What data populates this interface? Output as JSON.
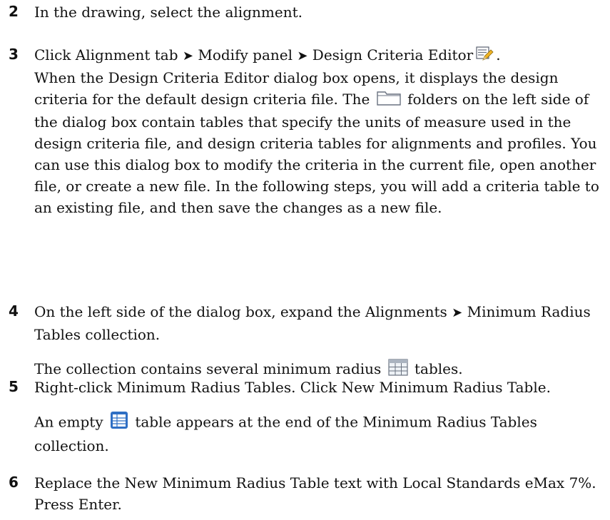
{
  "steps": [
    {
      "number": "2",
      "text": "In the drawing, select the alignment."
    },
    {
      "number": "3",
      "instruction": {
        "a": "Click Alignment tab",
        "b": "Modify panel",
        "c": "Design Criteria Editor",
        "d": "."
      },
      "note": {
        "a": "When the Design Criteria Editor dialog box opens, it displays the design criteria for the default design criteria file. The",
        "b": "folders on the left side of the dialog box contain tables that specify the units of measure used in the design criteria file, and design criteria tables for alignments and profiles. You can use this dialog box to modify the criteria in the current file, open another file, or create a new file. In the following steps, you will add a criteria table to an existing file, and then save the changes as a new file."
      }
    },
    {
      "number": "4",
      "instruction": {
        "a": "On the left side of the dialog box, expand the Alignments",
        "b": "Minimum Radius Tables collection."
      },
      "note": {
        "a": "The collection contains several minimum radius",
        "b": "tables."
      }
    },
    {
      "number": "5",
      "instruction": "Right-click Minimum Radius Tables. Click New Minimum Radius Table.",
      "note": {
        "a": "An empty",
        "b": "table appears at the end of the Minimum Radius Tables collection."
      }
    },
    {
      "number": "6",
      "instruction": "Replace the New Minimum Radius Table text with Local Standards eMax 7%. Press Enter."
    }
  ],
  "separator_glyph": "➤",
  "icons": {
    "design_criteria_editor": "design-criteria-editor-icon",
    "folder": "folder-icon",
    "table": "table-icon",
    "new_table": "new-table-icon"
  }
}
